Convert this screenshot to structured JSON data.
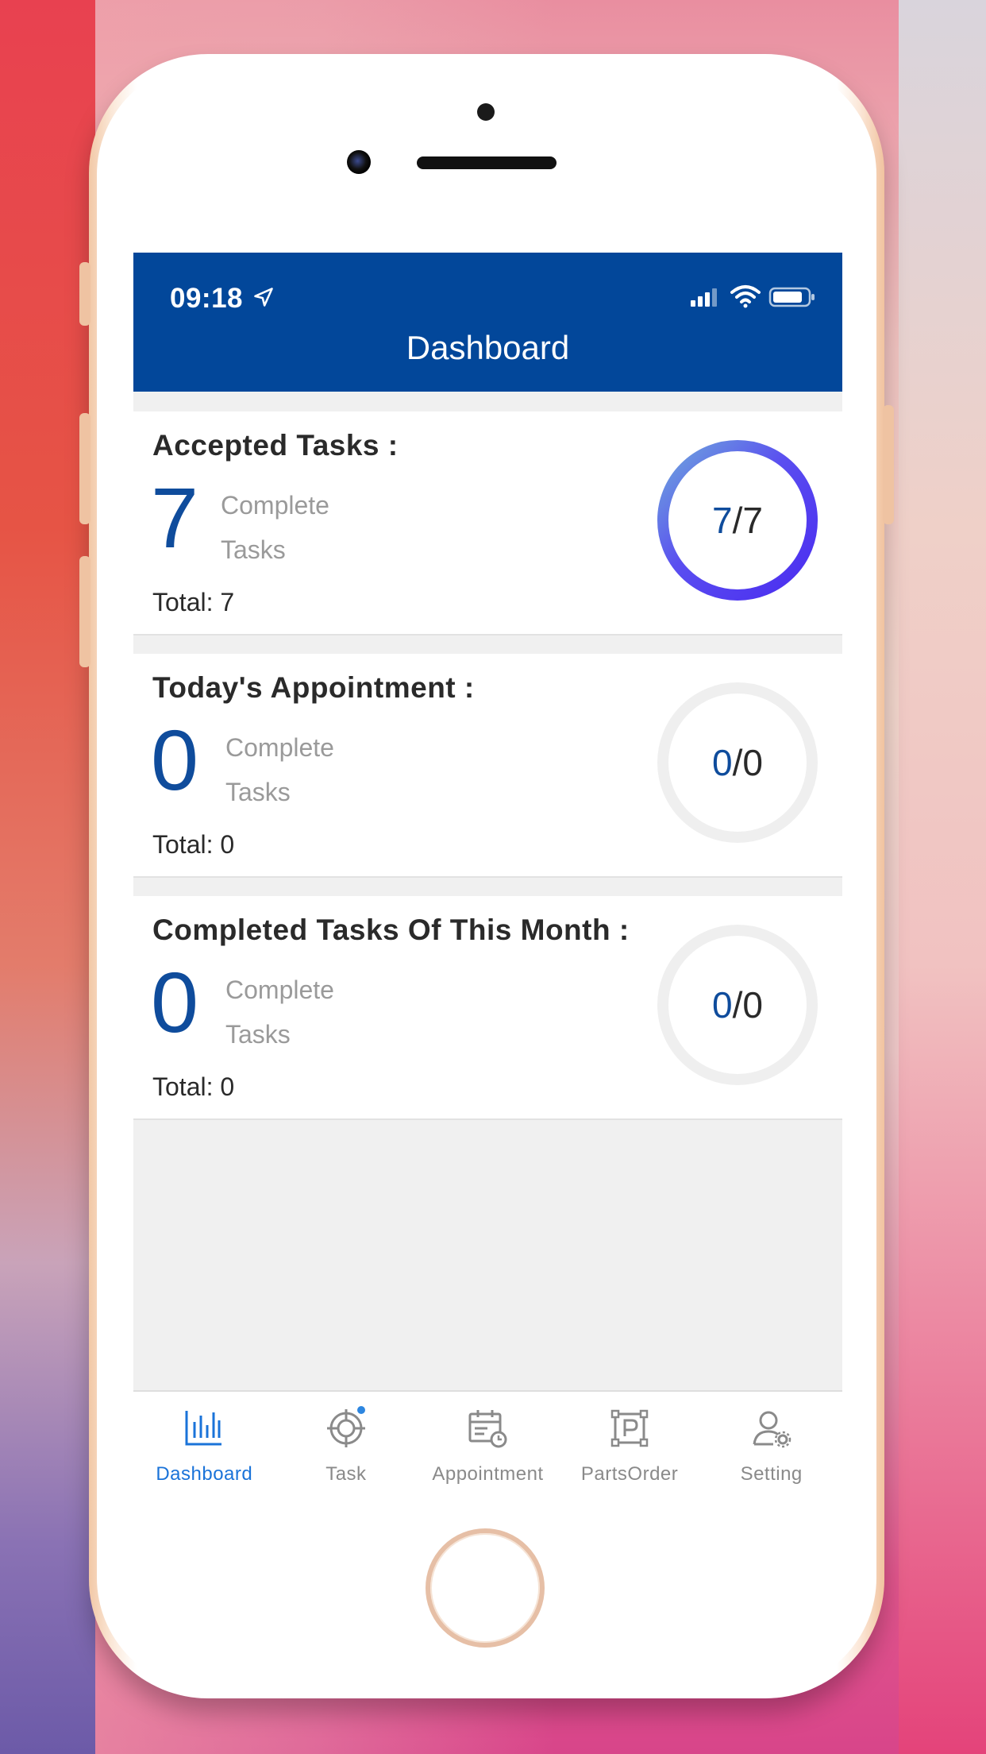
{
  "status_bar": {
    "time": "09:18"
  },
  "header": {
    "title": "Dashboard"
  },
  "cards": [
    {
      "title": "Accepted Tasks :",
      "completed": "7",
      "complete_label_1": "Complete",
      "complete_label_2": "Tasks",
      "total_text": "Total: 7",
      "ring_done": "7",
      "ring_sep": "/",
      "ring_total": "7",
      "progress": 1.0
    },
    {
      "title": "Today's Appointment :",
      "completed": "0",
      "complete_label_1": "Complete",
      "complete_label_2": "Tasks",
      "total_text": "Total: 0",
      "ring_done": "0",
      "ring_sep": "/",
      "ring_total": "0",
      "progress": 0
    },
    {
      "title": "Completed Tasks Of This Month :",
      "completed": "0",
      "complete_label_1": "Complete",
      "complete_label_2": "Tasks",
      "total_text": "Total: 0",
      "ring_done": "0",
      "ring_sep": "/",
      "ring_total": "0",
      "progress": 0
    }
  ],
  "tabs": [
    {
      "label": "Dashboard",
      "icon": "bar-chart-icon",
      "active": true
    },
    {
      "label": "Task",
      "icon": "target-icon",
      "badge": true
    },
    {
      "label": "Appointment",
      "icon": "calendar-clock-icon"
    },
    {
      "label": "PartsOrder",
      "icon": "parking-box-icon"
    },
    {
      "label": "Setting",
      "icon": "user-gear-icon"
    }
  ],
  "colors": {
    "header_bg": "#02479a",
    "accent_blue": "#0f4c9c",
    "active_tab": "#1a73d9",
    "ring_gradient_start": "#4a2cf0",
    "ring_gradient_end": "#6fa8dc",
    "ring_empty": "#efefef"
  }
}
